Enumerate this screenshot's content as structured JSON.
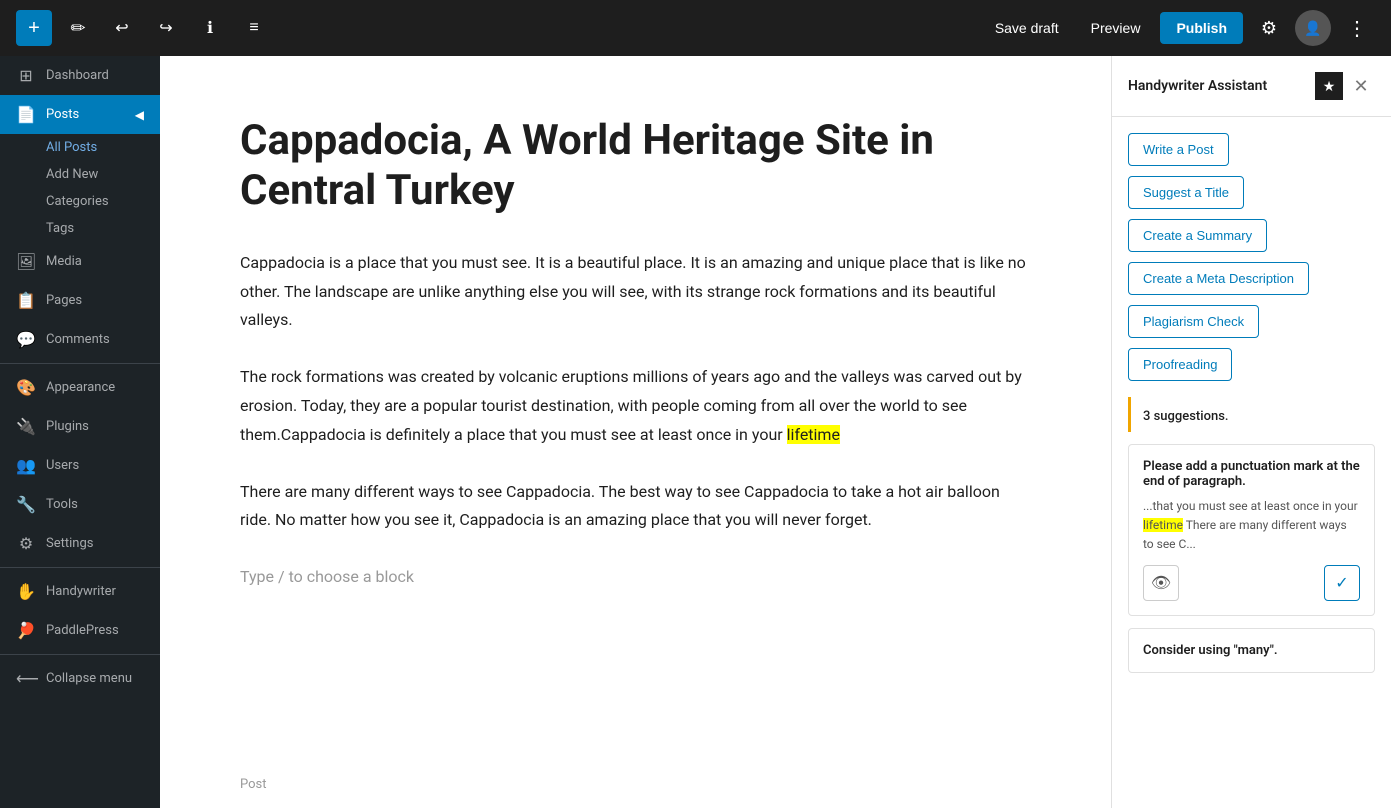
{
  "toolbar": {
    "save_draft": "Save draft",
    "preview": "Preview",
    "publish": "Publish"
  },
  "sidebar": {
    "dashboard_label": "Dashboard",
    "posts_label": "Posts",
    "all_posts_label": "All Posts",
    "add_new_label": "Add New",
    "categories_label": "Categories",
    "tags_label": "Tags",
    "media_label": "Media",
    "pages_label": "Pages",
    "comments_label": "Comments",
    "appearance_label": "Appearance",
    "plugins_label": "Plugins",
    "users_label": "Users",
    "tools_label": "Tools",
    "settings_label": "Settings",
    "handywriter_label": "Handywriter",
    "paddlepress_label": "PaddlePress",
    "collapse_label": "Collapse menu"
  },
  "editor": {
    "title": "Cappadocia, A World Heritage Site in Central Turkey",
    "paragraph1": "Cappadocia is a place that you must see. It is a beautiful place. It is an amazing and unique place that is like no other. The landscape are unlike anything else you will see, with its strange rock formations and its beautiful valleys.",
    "paragraph2": "The rock formations was created by volcanic eruptions millions of years ago and the valleys was carved out by erosion. Today, they are a popular tourist destination, with people coming from all over the world to see them.Cappadocia is definitely a place that you must see at least once in your lifetime",
    "paragraph3": "There are many different ways to see Cappadocia. The best way to see Cappadocia to take a hot air balloon ride. No matter how you see it, Cappadocia is an amazing place that you will never forget.",
    "placeholder": "Type / to choose a block",
    "footer": "Post",
    "highlighted_word": "lifetime"
  },
  "panel": {
    "title": "Handywriter Assistant",
    "write_post": "Write a Post",
    "suggest_title": "Suggest a Title",
    "create_summary": "Create a Summary",
    "create_meta": "Create a Meta Description",
    "plagiarism_check": "Plagiarism Check",
    "proofreading": "Proofreading",
    "suggestions_count": "3 suggestions.",
    "suggestion1_title": "Please add a punctuation mark at the end of paragraph.",
    "suggestion1_excerpt": "...that you must see at least once in your lifetime There are many different ways to see C...",
    "suggestion1_highlighted": "lifetime",
    "consider_title": "Consider using \"many\"."
  }
}
